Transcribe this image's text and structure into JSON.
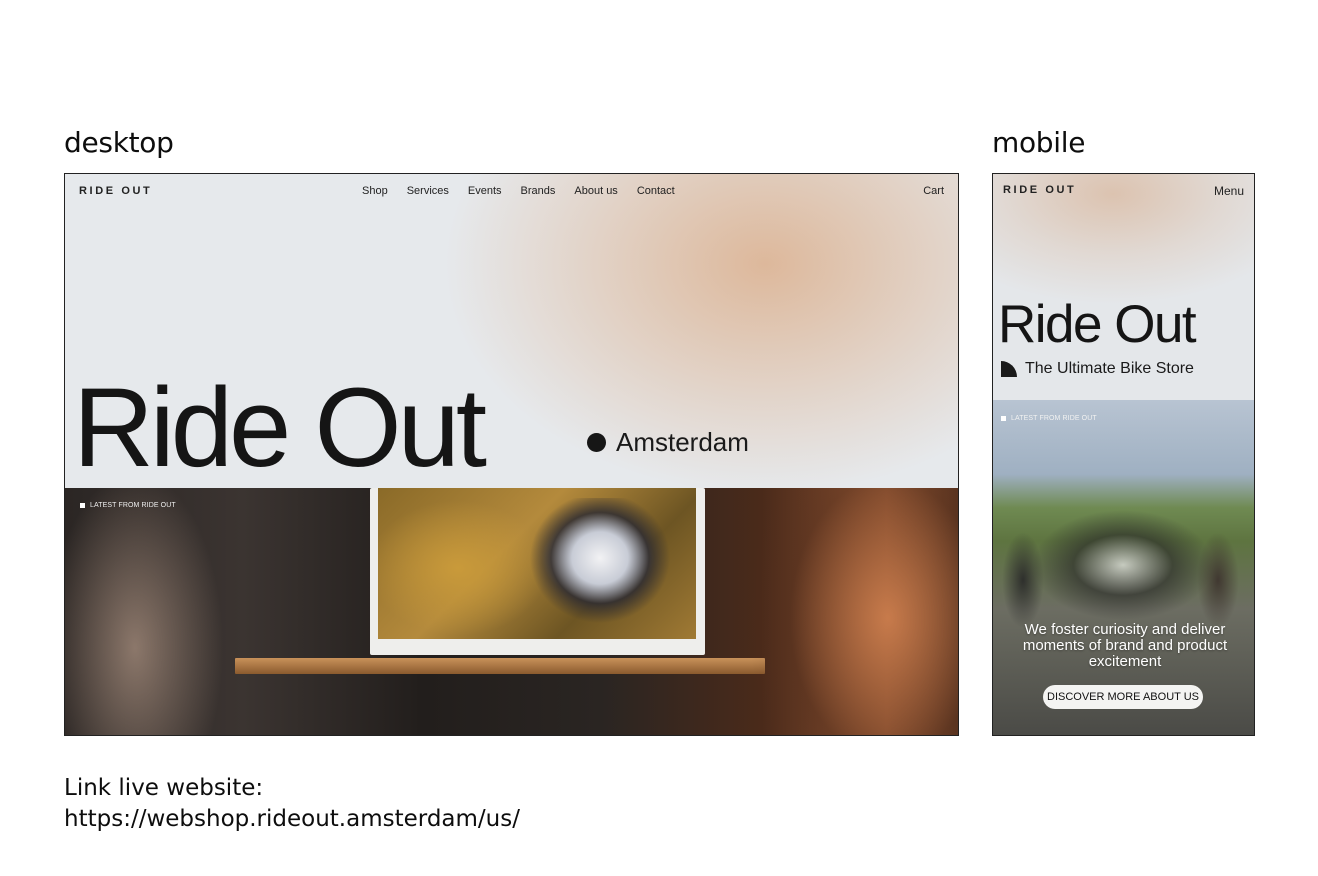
{
  "labels": {
    "desktop": "desktop",
    "mobile": "mobile"
  },
  "desktop": {
    "logo": "RIDE OUT",
    "nav": [
      "Shop",
      "Services",
      "Events",
      "Brands",
      "About us",
      "Contact"
    ],
    "cart": "Cart",
    "title": "Ride Out",
    "city": "Amsterdam",
    "latest": "LATEST FROM RIDE OUT"
  },
  "mobile": {
    "logo": "RIDE OUT",
    "menu": "Menu",
    "title": "Ride Out",
    "tagline": "The Ultimate Bike Store",
    "latest": "LATEST FROM RIDE OUT",
    "mission": "We foster curiosity and deliver moments of brand and product excitement",
    "cta": "DISCOVER MORE ABOUT US"
  },
  "footer": {
    "link_label": "Link live website:",
    "link_url": "https://webshop.rideout.amsterdam/us/"
  }
}
